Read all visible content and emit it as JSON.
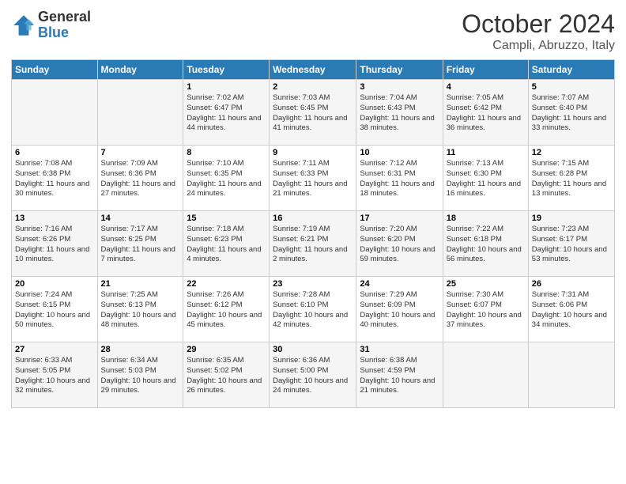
{
  "logo": {
    "general": "General",
    "blue": "Blue"
  },
  "title": "October 2024",
  "location": "Campli, Abruzzo, Italy",
  "days_of_week": [
    "Sunday",
    "Monday",
    "Tuesday",
    "Wednesday",
    "Thursday",
    "Friday",
    "Saturday"
  ],
  "weeks": [
    [
      {
        "day": "",
        "info": ""
      },
      {
        "day": "",
        "info": ""
      },
      {
        "day": "1",
        "info": "Sunrise: 7:02 AM\nSunset: 6:47 PM\nDaylight: 11 hours and 44 minutes."
      },
      {
        "day": "2",
        "info": "Sunrise: 7:03 AM\nSunset: 6:45 PM\nDaylight: 11 hours and 41 minutes."
      },
      {
        "day": "3",
        "info": "Sunrise: 7:04 AM\nSunset: 6:43 PM\nDaylight: 11 hours and 38 minutes."
      },
      {
        "day": "4",
        "info": "Sunrise: 7:05 AM\nSunset: 6:42 PM\nDaylight: 11 hours and 36 minutes."
      },
      {
        "day": "5",
        "info": "Sunrise: 7:07 AM\nSunset: 6:40 PM\nDaylight: 11 hours and 33 minutes."
      }
    ],
    [
      {
        "day": "6",
        "info": "Sunrise: 7:08 AM\nSunset: 6:38 PM\nDaylight: 11 hours and 30 minutes."
      },
      {
        "day": "7",
        "info": "Sunrise: 7:09 AM\nSunset: 6:36 PM\nDaylight: 11 hours and 27 minutes."
      },
      {
        "day": "8",
        "info": "Sunrise: 7:10 AM\nSunset: 6:35 PM\nDaylight: 11 hours and 24 minutes."
      },
      {
        "day": "9",
        "info": "Sunrise: 7:11 AM\nSunset: 6:33 PM\nDaylight: 11 hours and 21 minutes."
      },
      {
        "day": "10",
        "info": "Sunrise: 7:12 AM\nSunset: 6:31 PM\nDaylight: 11 hours and 18 minutes."
      },
      {
        "day": "11",
        "info": "Sunrise: 7:13 AM\nSunset: 6:30 PM\nDaylight: 11 hours and 16 minutes."
      },
      {
        "day": "12",
        "info": "Sunrise: 7:15 AM\nSunset: 6:28 PM\nDaylight: 11 hours and 13 minutes."
      }
    ],
    [
      {
        "day": "13",
        "info": "Sunrise: 7:16 AM\nSunset: 6:26 PM\nDaylight: 11 hours and 10 minutes."
      },
      {
        "day": "14",
        "info": "Sunrise: 7:17 AM\nSunset: 6:25 PM\nDaylight: 11 hours and 7 minutes."
      },
      {
        "day": "15",
        "info": "Sunrise: 7:18 AM\nSunset: 6:23 PM\nDaylight: 11 hours and 4 minutes."
      },
      {
        "day": "16",
        "info": "Sunrise: 7:19 AM\nSunset: 6:21 PM\nDaylight: 11 hours and 2 minutes."
      },
      {
        "day": "17",
        "info": "Sunrise: 7:20 AM\nSunset: 6:20 PM\nDaylight: 10 hours and 59 minutes."
      },
      {
        "day": "18",
        "info": "Sunrise: 7:22 AM\nSunset: 6:18 PM\nDaylight: 10 hours and 56 minutes."
      },
      {
        "day": "19",
        "info": "Sunrise: 7:23 AM\nSunset: 6:17 PM\nDaylight: 10 hours and 53 minutes."
      }
    ],
    [
      {
        "day": "20",
        "info": "Sunrise: 7:24 AM\nSunset: 6:15 PM\nDaylight: 10 hours and 50 minutes."
      },
      {
        "day": "21",
        "info": "Sunrise: 7:25 AM\nSunset: 6:13 PM\nDaylight: 10 hours and 48 minutes."
      },
      {
        "day": "22",
        "info": "Sunrise: 7:26 AM\nSunset: 6:12 PM\nDaylight: 10 hours and 45 minutes."
      },
      {
        "day": "23",
        "info": "Sunrise: 7:28 AM\nSunset: 6:10 PM\nDaylight: 10 hours and 42 minutes."
      },
      {
        "day": "24",
        "info": "Sunrise: 7:29 AM\nSunset: 6:09 PM\nDaylight: 10 hours and 40 minutes."
      },
      {
        "day": "25",
        "info": "Sunrise: 7:30 AM\nSunset: 6:07 PM\nDaylight: 10 hours and 37 minutes."
      },
      {
        "day": "26",
        "info": "Sunrise: 7:31 AM\nSunset: 6:06 PM\nDaylight: 10 hours and 34 minutes."
      }
    ],
    [
      {
        "day": "27",
        "info": "Sunrise: 6:33 AM\nSunset: 5:05 PM\nDaylight: 10 hours and 32 minutes."
      },
      {
        "day": "28",
        "info": "Sunrise: 6:34 AM\nSunset: 5:03 PM\nDaylight: 10 hours and 29 minutes."
      },
      {
        "day": "29",
        "info": "Sunrise: 6:35 AM\nSunset: 5:02 PM\nDaylight: 10 hours and 26 minutes."
      },
      {
        "day": "30",
        "info": "Sunrise: 6:36 AM\nSunset: 5:00 PM\nDaylight: 10 hours and 24 minutes."
      },
      {
        "day": "31",
        "info": "Sunrise: 6:38 AM\nSunset: 4:59 PM\nDaylight: 10 hours and 21 minutes."
      },
      {
        "day": "",
        "info": ""
      },
      {
        "day": "",
        "info": ""
      }
    ]
  ]
}
